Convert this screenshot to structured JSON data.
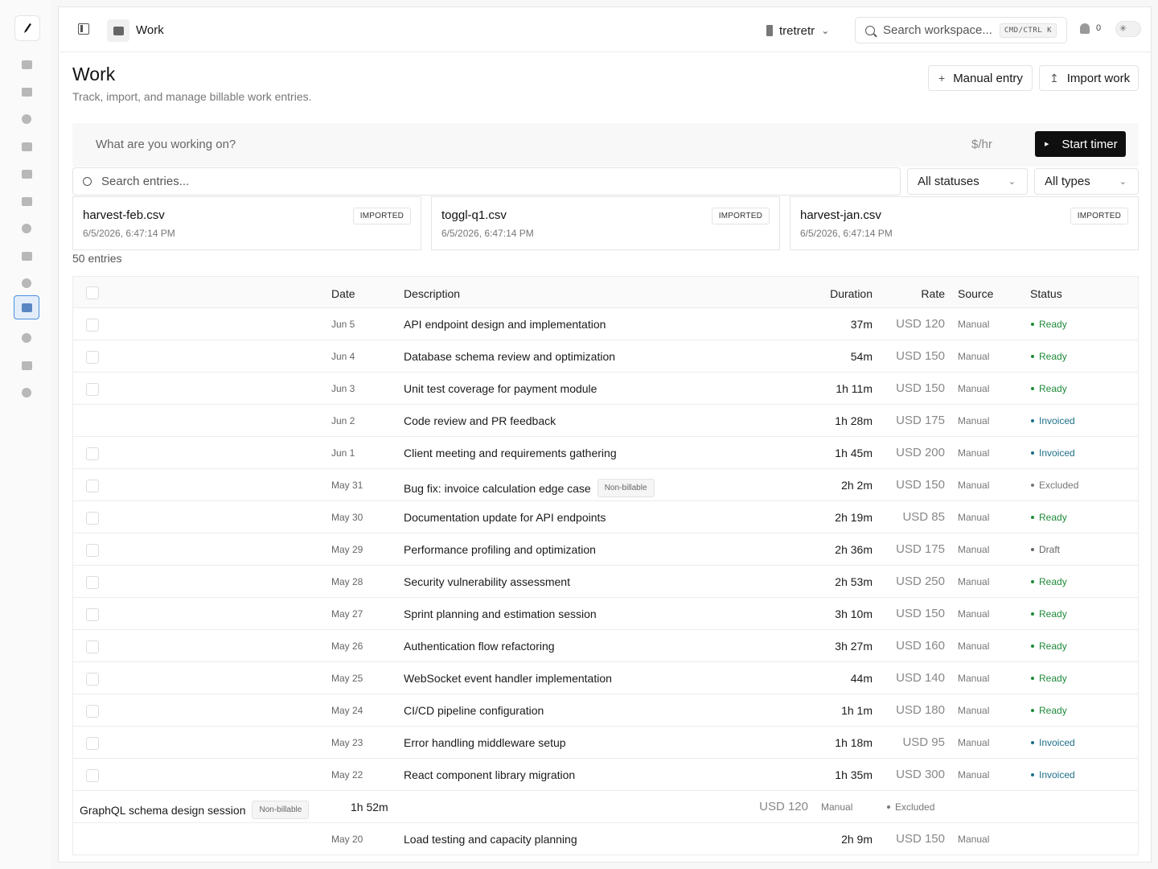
{
  "app": {
    "breadcrumb_title": "Work",
    "workspace_name": "tretretr",
    "search_placeholder": "Search workspace...",
    "search_shortcut": "CMD/CTRL K",
    "notification_count": "0"
  },
  "sidebar": {
    "items": [
      {
        "name": "inbox-icon"
      },
      {
        "name": "sparkle-icon"
      },
      {
        "name": "globe-icon"
      },
      {
        "name": "documents-icon"
      },
      {
        "name": "card-icon"
      },
      {
        "name": "file-icon"
      },
      {
        "name": "bell-icon"
      },
      {
        "name": "file-refresh-icon"
      },
      {
        "name": "clock-icon"
      },
      {
        "name": "work-icon",
        "active": true
      },
      {
        "name": "people-icon"
      },
      {
        "name": "building-icon"
      },
      {
        "name": "alert-icon"
      }
    ]
  },
  "page": {
    "title": "Work",
    "subtitle": "Track, import, and manage billable work entries.",
    "manual_entry_label": "Manual entry",
    "import_work_label": "Import work"
  },
  "timer": {
    "placeholder": "What are you working on?",
    "rate_placeholder": "$/hr",
    "start_label": "Start timer"
  },
  "filters": {
    "search_placeholder": "Search entries...",
    "status_selected": "All statuses",
    "type_selected": "All types"
  },
  "imports": [
    {
      "file": "harvest-feb.csv",
      "date": "6/5/2026, 6:47:14 PM",
      "badge": "IMPORTED"
    },
    {
      "file": "toggl-q1.csv",
      "date": "6/5/2026, 6:47:14 PM",
      "badge": "IMPORTED"
    },
    {
      "file": "harvest-jan.csv",
      "date": "6/5/2026, 6:47:14 PM",
      "badge": "IMPORTED"
    }
  ],
  "entries_count": "50 entries",
  "table": {
    "headers": {
      "date": "Date",
      "description": "Description",
      "duration": "Duration",
      "rate": "Rate",
      "source": "Source",
      "status": "Status"
    },
    "rows": [
      {
        "date": "Jun 5",
        "description": "API endpoint design and implementation",
        "duration": "37m",
        "rate": "USD 120",
        "source": "Manual",
        "status": "Ready",
        "checkbox": true
      },
      {
        "date": "Jun 4",
        "description": "Database schema review and optimization",
        "duration": "54m",
        "rate": "USD 150",
        "source": "Manual",
        "status": "Ready",
        "checkbox": true
      },
      {
        "date": "Jun 3",
        "description": "Unit test coverage for payment module",
        "duration": "1h 11m",
        "rate": "USD 150",
        "source": "Manual",
        "status": "Ready",
        "checkbox": true
      },
      {
        "date": "Jun 2",
        "description": "Code review and PR feedback",
        "duration": "1h 28m",
        "rate": "USD 175",
        "source": "Manual",
        "status": "Invoiced",
        "checkbox": false
      },
      {
        "date": "Jun 1",
        "description": "Client meeting and requirements gathering",
        "duration": "1h 45m",
        "rate": "USD 200",
        "source": "Manual",
        "status": "Invoiced",
        "checkbox": true
      },
      {
        "date": "May 31",
        "description": "Bug fix: invoice calculation edge case",
        "badge": "Non-billable",
        "duration": "2h 2m",
        "rate": "USD 150",
        "source": "Manual",
        "status": "Excluded",
        "checkbox": true
      },
      {
        "date": "May 30",
        "description": "Documentation update for API endpoints",
        "duration": "2h 19m",
        "rate": "USD 85",
        "source": "Manual",
        "status": "Ready",
        "checkbox": true
      },
      {
        "date": "May 29",
        "description": "Performance profiling and optimization",
        "duration": "2h 36m",
        "rate": "USD 175",
        "source": "Manual",
        "status": "Draft",
        "checkbox": true
      },
      {
        "date": "May 28",
        "description": "Security vulnerability assessment",
        "duration": "2h 53m",
        "rate": "USD 250",
        "source": "Manual",
        "status": "Ready",
        "checkbox": true
      },
      {
        "date": "May 27",
        "description": "Sprint planning and estimation session",
        "duration": "3h 10m",
        "rate": "USD 150",
        "source": "Manual",
        "status": "Ready",
        "checkbox": true
      },
      {
        "date": "May 26",
        "description": "Authentication flow refactoring",
        "duration": "3h 27m",
        "rate": "USD 160",
        "source": "Manual",
        "status": "Ready",
        "checkbox": true
      },
      {
        "date": "May 25",
        "description": "WebSocket event handler implementation",
        "duration": "44m",
        "rate": "USD 140",
        "source": "Manual",
        "status": "Ready",
        "checkbox": true
      },
      {
        "date": "May 24",
        "description": "CI/CD pipeline configuration",
        "duration": "1h 1m",
        "rate": "USD 180",
        "source": "Manual",
        "status": "Ready",
        "checkbox": true
      },
      {
        "date": "May 23",
        "description": "Error handling middleware setup",
        "duration": "1h 18m",
        "rate": "USD 95",
        "source": "Manual",
        "status": "Invoiced",
        "checkbox": true
      },
      {
        "date": "May 22",
        "description": "React component library migration",
        "duration": "1h 35m",
        "rate": "USD 300",
        "source": "Manual",
        "status": "Invoiced",
        "checkbox": true
      },
      {
        "date": "",
        "description": "GraphQL schema design session",
        "badge": "Non-billable",
        "duration": "1h 52m",
        "rate": "USD 120",
        "source": "Manual",
        "status": "Excluded",
        "checkbox": false,
        "broken": true
      },
      {
        "date": "May 20",
        "description": "Load testing and capacity planning",
        "duration": "2h 9m",
        "rate": "USD 150",
        "source": "Manual",
        "status": "",
        "checkbox": false
      }
    ]
  },
  "status_colors": {
    "Ready": "#1f8a3a",
    "Invoiced": "#1f6f8a",
    "Excluded": "#777777",
    "Draft": "#666666"
  }
}
